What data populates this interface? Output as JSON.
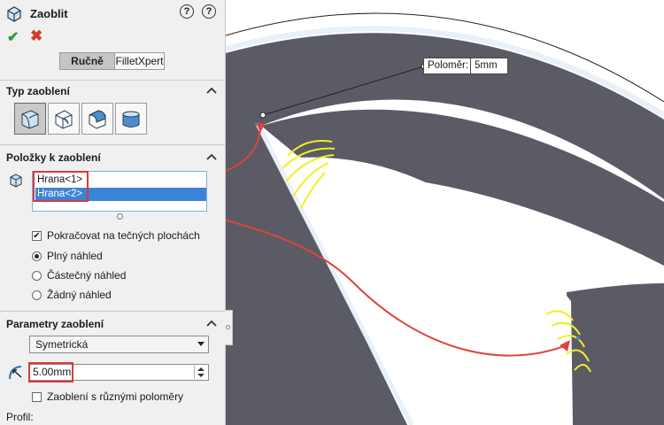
{
  "title": "Zaoblit",
  "help_icons": [
    "help-flag-icon",
    "help-icon"
  ],
  "actions": {
    "ok": "✔",
    "cancel": "✖"
  },
  "tabs": [
    {
      "label": "Ručně",
      "active": true
    },
    {
      "label": "FilletXpert",
      "active": false
    }
  ],
  "sections": {
    "fillet_type": {
      "title": "Typ zaoblení",
      "types": [
        "constant-radius-fillet-icon",
        "variable-radius-fillet-icon",
        "face-fillet-icon",
        "full-round-fillet-icon"
      ],
      "selected_index": 0
    },
    "items": {
      "title": "Položky k zaoblení",
      "list": [
        "Hrana<1>",
        "Hrana<2>"
      ],
      "selected_index": 1,
      "tangent_label": "Pokračovat na tečných plochách",
      "tangent_checked": true,
      "preview_options": [
        "Plný náhled",
        "Částečný náhled",
        "Žádný náhled"
      ],
      "preview_selected": 0
    },
    "params": {
      "title": "Parametry zaoblení",
      "method": "Symetrická",
      "radius": "5.00mm",
      "multi_radius_label": "Zaoblení s různými poloměry",
      "multi_radius_checked": false
    },
    "profile_label": "Profil:"
  },
  "callout": {
    "label": "Poloměr:",
    "value": "5mm"
  },
  "colors": {
    "part": "#5b5b66",
    "edge_highlight": "#e8f0f8",
    "preview": "#f4ef1e",
    "arrow": "#e0453a",
    "highlight_box": "#d83a3a",
    "accent": "#3c84d6"
  }
}
